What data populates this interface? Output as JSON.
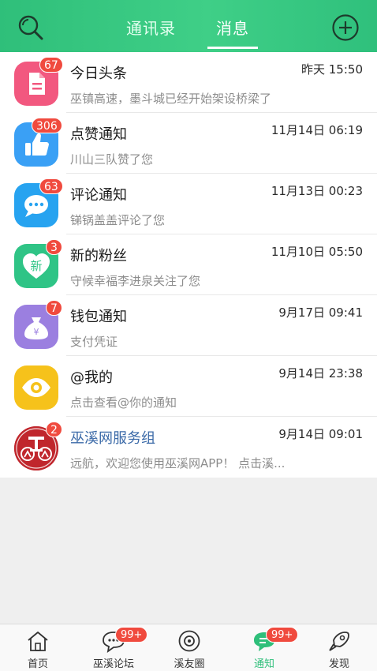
{
  "header": {
    "tabs": [
      {
        "label": "通讯录",
        "active": false
      },
      {
        "label": "消息",
        "active": true
      }
    ],
    "icons": {
      "search": "search-icon",
      "add": "plus-circle-icon"
    },
    "color": "#3fcf87"
  },
  "messages": [
    {
      "title": "今日头条",
      "time": "昨天 15:50",
      "preview": "巫镇高速，墨斗城已经开始架设桥梁了",
      "badge": "67",
      "icon": "document-icon",
      "color": "#f2587f"
    },
    {
      "title": "点赞通知",
      "time": "11月14日 06:19",
      "preview": "川山三队赞了您",
      "badge": "306",
      "icon": "thumbs-up-icon",
      "color": "#3aa0f5"
    },
    {
      "title": "评论通知",
      "time": "11月13日 00:23",
      "preview": "锑锅盖盖评论了您",
      "badge": "63",
      "icon": "chat-bubble-icon",
      "color": "#27a3f0"
    },
    {
      "title": "新的粉丝",
      "time": "11月10日 05:50",
      "preview": "守候幸福李进泉关注了您",
      "badge": "3",
      "icon": "new-heart-icon",
      "avatar_text": "新",
      "color": "#2fc486"
    },
    {
      "title": "钱包通知",
      "time": "9月17日 09:41",
      "preview": "支付凭证",
      "badge": "7",
      "icon": "money-bag-icon",
      "avatar_text": "¥",
      "color": "#9b7fe0"
    },
    {
      "title": "@我的",
      "time": "9月14日 23:38",
      "preview": "点击查看@你的通知",
      "badge": "",
      "icon": "eye-icon",
      "color": "#f6c21b"
    },
    {
      "title": "巫溪网服务组",
      "time": "9月14日 09:01",
      "preview": "远航，欢迎您使用巫溪网APP！ 点击溪...",
      "badge": "2",
      "icon": "service-logo-icon",
      "color": "#c0262c"
    }
  ],
  "bottom_nav": [
    {
      "label": "首页",
      "icon": "home-icon",
      "badge": "",
      "active": false
    },
    {
      "label": "巫溪论坛",
      "icon": "forum-icon",
      "badge": "99+",
      "active": false
    },
    {
      "label": "溪友圈",
      "icon": "camera-circle-icon",
      "badge": "",
      "active": false
    },
    {
      "label": "通知",
      "icon": "notification-chat-icon",
      "badge": "99+",
      "active": true
    },
    {
      "label": "发现",
      "icon": "rocket-icon",
      "badge": "",
      "active": false
    }
  ]
}
